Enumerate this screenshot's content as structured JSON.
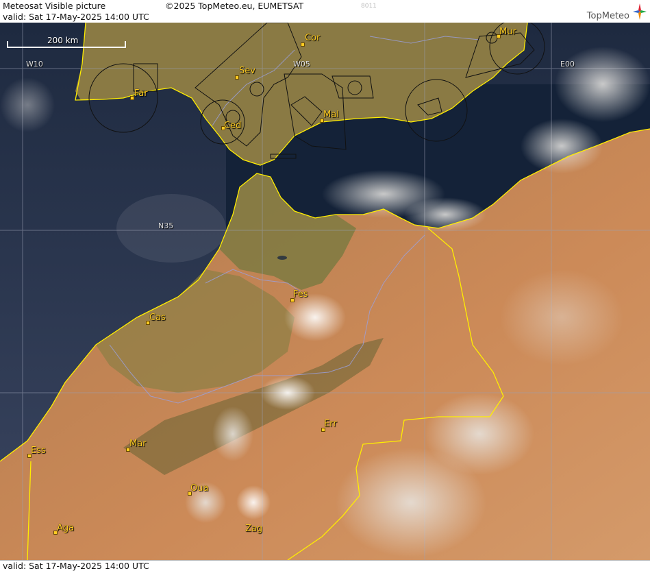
{
  "header": {
    "title": "Meteosat Visible picture",
    "copyright": "©2025 TopMeteo.eu, EUMETSAT",
    "valid_line": "valid:  Sat  17-May-2025  14:00 UTC",
    "code": "8011",
    "logo_text": "TopMeteo"
  },
  "footer": {
    "valid_line": "valid:  Sat  17-May-2025  14:00 UTC"
  },
  "scale": {
    "label": "200 km"
  },
  "grid_labels": {
    "w10": "W10",
    "w05": "W05",
    "e00": "E00",
    "n35": "N35"
  },
  "cities": {
    "cor": "Cor",
    "mur": "Mur",
    "sev": "Sev",
    "far": "Far",
    "ced": "Ced",
    "mal": "Mal",
    "fes": "Fes",
    "cas": "Cas",
    "err": "Err",
    "ess": "Ess",
    "mar": "Mar",
    "oua": "Oua",
    "aga": "Aga",
    "zag": "Zag"
  },
  "colors": {
    "sea": "#1f2f45",
    "ocean": "#2c3c56",
    "land_iberia": "#8a7640",
    "land_sahara": "#c98a5a",
    "border": "#ffee00",
    "river": "#9aa0e0",
    "city": "#ffcc22"
  }
}
